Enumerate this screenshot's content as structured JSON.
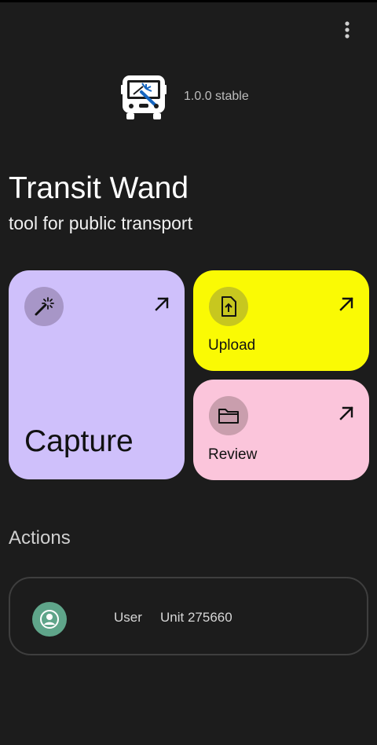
{
  "app": {
    "title": "Transit Wand",
    "subtitle": "tool for public transport",
    "version": "1.0.0 stable",
    "logo_icon": "bus-wand-logo-icon"
  },
  "toolbar": {
    "menu_icon": "more-vert-icon"
  },
  "tiles": {
    "capture": {
      "label": "Capture",
      "icon": "magic-wand-icon",
      "arrow_icon": "arrow-outward-icon",
      "color": "#cfc0fb"
    },
    "upload": {
      "label": "Upload",
      "icon": "file-upload-icon",
      "arrow_icon": "arrow-outward-icon",
      "color": "#fafa04"
    },
    "review": {
      "label": "Review",
      "icon": "folder-icon",
      "arrow_icon": "arrow-outward-icon",
      "color": "#fbc5db"
    }
  },
  "actions": {
    "title": "Actions",
    "user": {
      "label": "User",
      "unit": "Unit 275660",
      "avatar_icon": "account-circle-icon",
      "avatar_color": "#5fa58a"
    }
  }
}
